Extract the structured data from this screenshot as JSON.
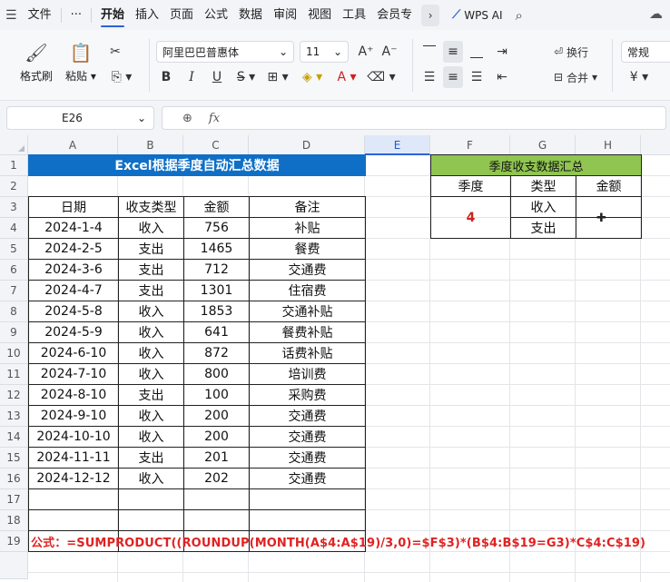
{
  "menu": {
    "hamburger_icon": "hamburger-icon",
    "file": "文件",
    "more": "···",
    "tabs": [
      "开始",
      "插入",
      "页面",
      "公式",
      "数据",
      "审阅",
      "视图",
      "工具",
      "会员专"
    ],
    "active_tab": "开始",
    "ai_label": "WPS AI"
  },
  "ribbon": {
    "format_painter": "格式刷",
    "paste": "粘贴",
    "font_name": "阿里巴巴普惠体",
    "font_size": "11",
    "bold": "B",
    "italic": "I",
    "underline": "U",
    "wrap": "换行",
    "merge": "合并",
    "number_format": "常规",
    "currency": "¥"
  },
  "formula_bar": {
    "cell_ref": "E26",
    "zoom_icon": "zoom-icon",
    "fx": "fx",
    "content": ""
  },
  "columns": [
    "A",
    "B",
    "C",
    "D",
    "E",
    "F",
    "G",
    "H"
  ],
  "selected_column": "E",
  "rows": [
    "1",
    "2",
    "3",
    "4",
    "5",
    "6",
    "7",
    "8",
    "9",
    "10",
    "11",
    "12",
    "13",
    "14",
    "15",
    "16",
    "17",
    "18",
    "19"
  ],
  "sheet": {
    "title": "Excel根据季度自动汇总数据",
    "headers": [
      "日期",
      "收支类型",
      "金额",
      "备注"
    ],
    "records": [
      [
        "2024-1-4",
        "收入",
        "756",
        "补贴"
      ],
      [
        "2024-2-5",
        "支出",
        "1465",
        "餐费"
      ],
      [
        "2024-3-6",
        "支出",
        "712",
        "交通费"
      ],
      [
        "2024-4-7",
        "支出",
        "1301",
        "住宿费"
      ],
      [
        "2024-5-8",
        "收入",
        "1853",
        "交通补贴"
      ],
      [
        "2024-5-9",
        "收入",
        "641",
        "餐费补贴"
      ],
      [
        "2024-6-10",
        "收入",
        "872",
        "话费补贴"
      ],
      [
        "2024-7-10",
        "收入",
        "800",
        "培训费"
      ],
      [
        "2024-8-10",
        "支出",
        "100",
        "采购费"
      ],
      [
        "2024-9-10",
        "收入",
        "200",
        "交通费"
      ],
      [
        "2024-10-10",
        "收入",
        "200",
        "交通费"
      ],
      [
        "2024-11-11",
        "支出",
        "201",
        "交通费"
      ],
      [
        "2024-12-12",
        "收入",
        "202",
        "交通费"
      ]
    ],
    "formula_note": "公式：=SUMPRODUCT((ROUNDUP(MONTH(A$4:A$19)/3,0)=$F$3)*(B$4:B$19=G3)*C$4:C$19)"
  },
  "summary": {
    "title": "季度收支数据汇总",
    "headers": [
      "季度",
      "类型",
      "金额"
    ],
    "season": "4",
    "types": [
      "收入",
      "支出"
    ],
    "amounts": [
      "",
      ""
    ]
  },
  "colors": {
    "title_bg": "#0f6fc6",
    "summary_bg": "#8fc550",
    "formula_red": "#e02222",
    "accent_blue": "#2a63d9"
  }
}
